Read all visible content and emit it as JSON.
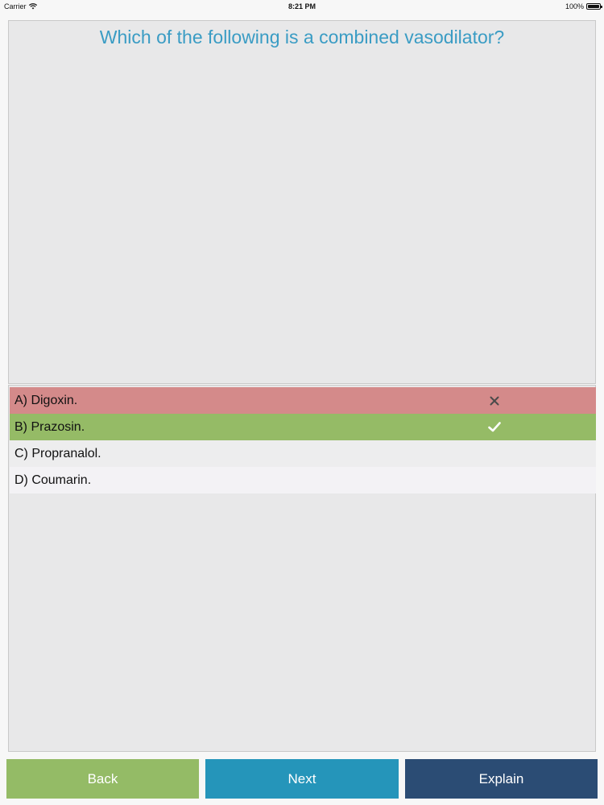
{
  "status_bar": {
    "carrier": "Carrier",
    "time": "8:21 PM",
    "battery": "100%"
  },
  "question": {
    "text": "Which of the following is a combined vasodilator?",
    "color": "#3a9cc4"
  },
  "answers": [
    {
      "label": "A) Digoxin.",
      "state": "incorrect",
      "mark": "close-icon",
      "color": "#d48a8a"
    },
    {
      "label": "B) Prazosin.",
      "state": "correct",
      "mark": "check-icon",
      "color": "#95bb66"
    },
    {
      "label": "C) Propranalol.",
      "state": "neutral",
      "mark": "",
      "color": "#ededee"
    },
    {
      "label": "D) Coumarin.",
      "state": "neutral",
      "mark": "",
      "color": "#f3f2f5"
    }
  ],
  "buttons": {
    "back": {
      "label": "Back",
      "color": "#94bb66"
    },
    "next": {
      "label": "Next",
      "color": "#2595ba"
    },
    "explain": {
      "label": "Explain",
      "color": "#2b4c74"
    }
  }
}
